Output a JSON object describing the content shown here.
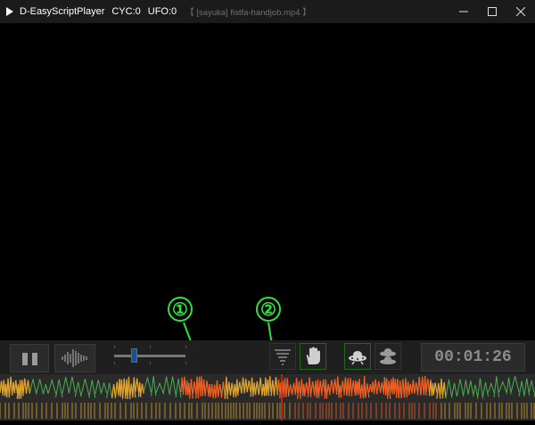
{
  "window": {
    "app_name": "D-EasyScriptPlayer",
    "cyc": "CYC:0",
    "ufo": "UFO:0",
    "file": "【 [sayuka] fistfa-handjob.mp4 】"
  },
  "controls": {
    "pause_icon": "pause-icon",
    "waveform_icon": "waveform-icon",
    "mode_icons": [
      "tornado-icon",
      "hand-icon",
      "ufo-icon",
      "ufo-twin-icon"
    ]
  },
  "time": {
    "current": "00:01:26"
  },
  "callouts": {
    "one": "①",
    "two": "②"
  },
  "colors": {
    "accent_green": "#29e43a",
    "wave_green": "#4caf50",
    "wave_yellow": "#e0a52a",
    "wave_orange": "#f06020",
    "wave_red": "#e02a10"
  }
}
